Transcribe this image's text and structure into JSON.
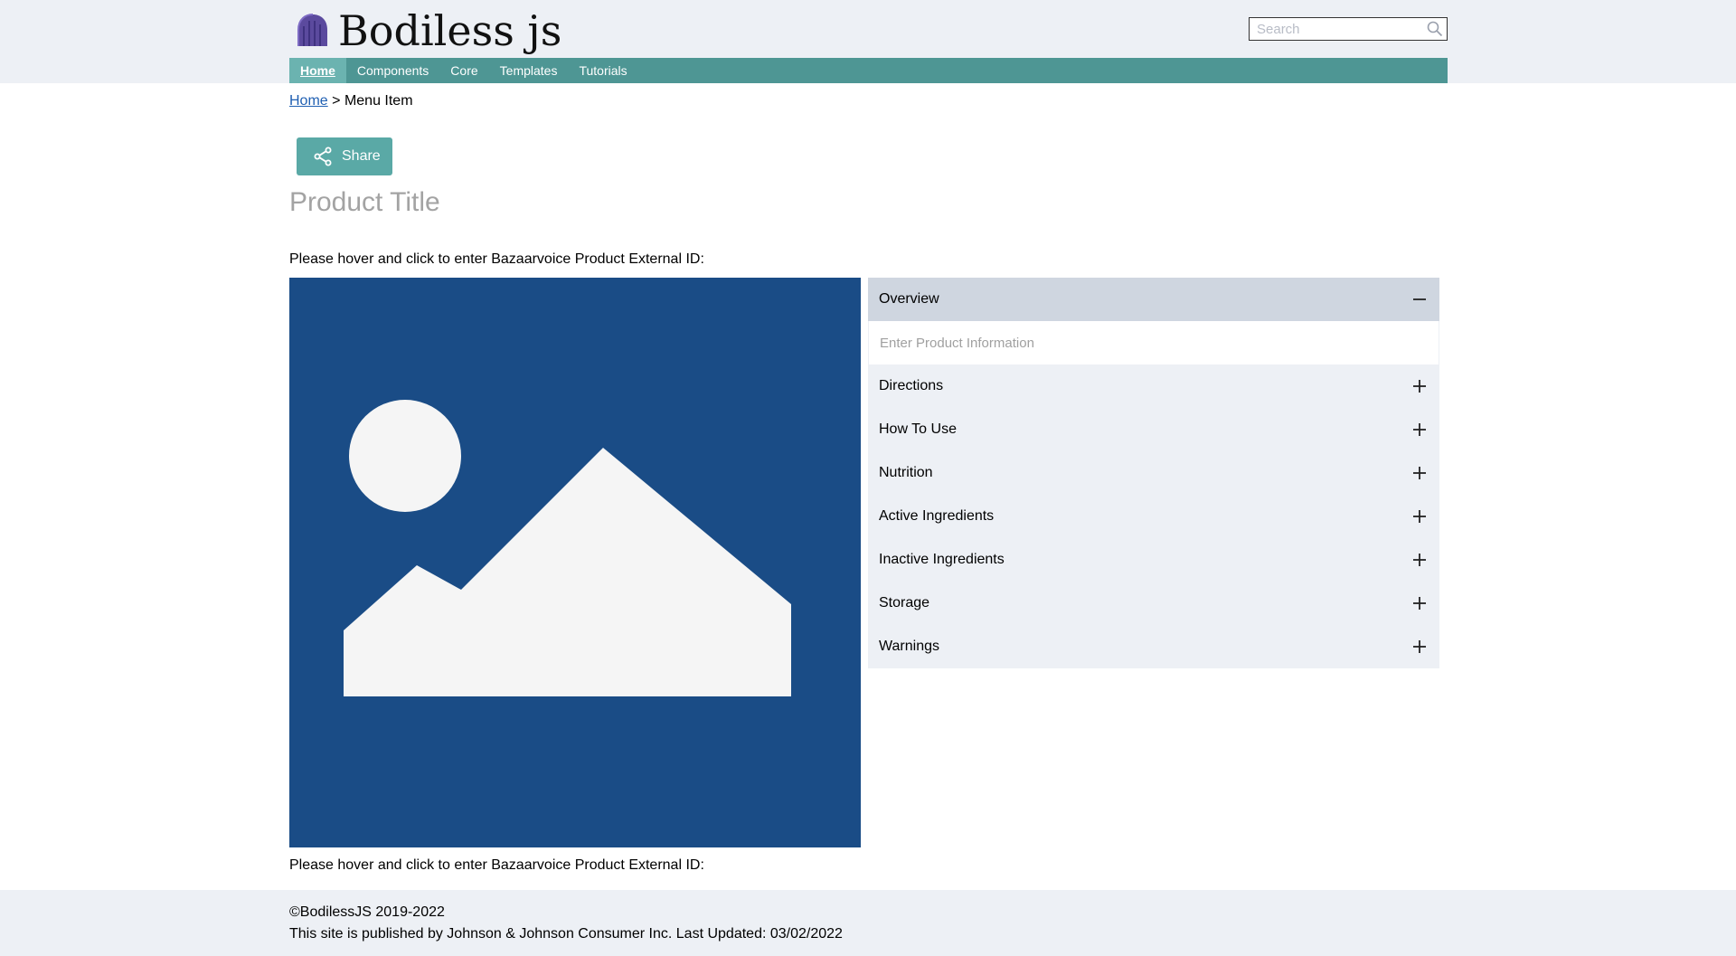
{
  "header": {
    "logo_text": "Bodiless js",
    "search_placeholder": "Search"
  },
  "nav": {
    "items": [
      {
        "label": "Home",
        "active": true
      },
      {
        "label": "Components"
      },
      {
        "label": "Core"
      },
      {
        "label": "Templates"
      },
      {
        "label": "Tutorials"
      }
    ]
  },
  "breadcrumb": {
    "home": "Home",
    "separator": ">",
    "current": "Menu Item"
  },
  "share_label": "Share",
  "product_title": "Product Title",
  "bv_prompt_top": "Please hover and click to enter Bazaarvoice Product External ID:",
  "bv_prompt_bottom": "Please hover and click to enter Bazaarvoice Product External ID:",
  "accordion": {
    "overview": {
      "label": "Overview",
      "placeholder": "Enter Product Information"
    },
    "items": [
      {
        "label": "Directions"
      },
      {
        "label": "How To Use"
      },
      {
        "label": "Nutrition"
      },
      {
        "label": "Active Ingredients"
      },
      {
        "label": "Inactive Ingredients"
      },
      {
        "label": "Storage"
      },
      {
        "label": "Warnings"
      }
    ]
  },
  "footer": {
    "copyright": "©BodilessJS 2019-2022",
    "published": "This site is published by Johnson & Johnson Consumer Inc. Last Updated: 03/02/2022"
  },
  "colors": {
    "header_bg": "#edf0f5",
    "nav_bg": "#4e9694",
    "nav_active_bg": "#6bb3b0",
    "share_bg": "#5aa9a6",
    "image_bg": "#1a4c86",
    "accordion_open_bg": "#cfd6e0"
  }
}
